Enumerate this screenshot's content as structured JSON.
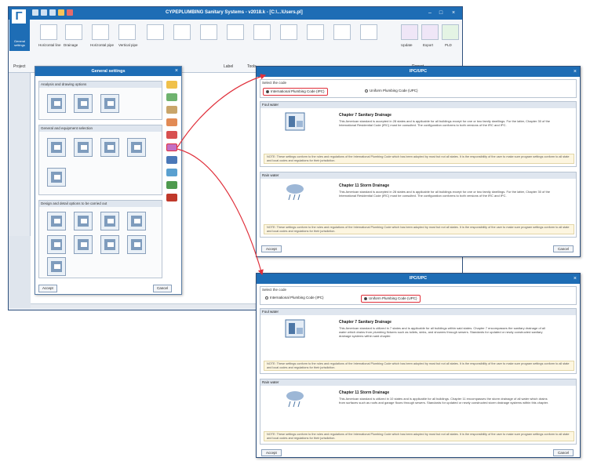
{
  "app": {
    "title": "CYPEPLUMBING Sanitary Systems - v2018.k - [C:\\...\\Users.pl]",
    "ribbon_tabs": [
      "Project",
      "Label",
      "Tools",
      "Report"
    ],
    "general_settings_label": "General settings",
    "ribbon_groups": [
      "Horizontal line",
      "Drainage",
      "Horizontal pipe",
      "Vertical pipe",
      "Update",
      "Export",
      "PLD"
    ]
  },
  "general_settings_dialog": {
    "title": "General settings",
    "sections": [
      {
        "title": "Analysis and drawing options"
      },
      {
        "title": "General and equipment selection"
      },
      {
        "title": "Design and detail options to be carried out"
      }
    ],
    "accept": "Accept",
    "cancel": "Cancel"
  },
  "ipc_dialog": {
    "title": "IPC/UPC",
    "select_label": "Select the code",
    "option_ipc": "International Plumbing Code (IPC)",
    "option_upc": "Uniform Plumbing Code (UPC)",
    "foul_label": "Foul water",
    "foul_title": "Chapter 7 Sanitary Drainage",
    "foul_body": "This American standard is accepted in 28 states and is applicable for all buildings except for one or two family dwellings. For the latter, Chapter 30 of the International Residential Code (IRC) must be consulted. The configuration conforms to both versions of the IRC and IPC.",
    "note": "NOTE: These settings conform to the rules and regulations of the International Plumbing Code which has been adopted by most but not all states. It is the responsibility of the user to make sure program settings conform to all state and local codes and regulations for their jurisdiction.",
    "rain_label": "Rain water",
    "rain_title": "Chapter 11 Storm Drainage",
    "rain_body": "This American standard is accepted in 28 states and is applicable for all buildings except for one or two family dwellings. For the latter, Chapter 30 of the International Residential Code (IRC) must be consulted. The configuration conforms to both versions of the IRC and IPC.",
    "accept": "Accept",
    "cancel": "Cancel"
  },
  "upc_dialog": {
    "title": "IPC/UPC",
    "select_label": "Select the code",
    "option_ipc": "International Plumbing Code (IPC)",
    "option_upc": "Uniform Plumbing Code (UPC)",
    "foul_label": "Foul water",
    "foul_title": "Chapter 7 Sanitary Drainage",
    "foul_body": "This American standard is utilized in 7 states and is applicable for all buildings within said states. Chapter 7 encompasses the sanitary drainage of all water which drains from plumbing fixtures such as toilets, sinks, and showers through sewers. Standards for updated or newly constructed sanitary drainage systems within said chapter.",
    "note": "NOTE: These settings conform to the rules and regulations of the International Plumbing Code which has been adopted by most but not all states. It is the responsibility of the user to make sure program settings conform to all state and local codes and regulations for their jurisdiction.",
    "rain_label": "Rain water",
    "rain_title": "Chapter 11 Storm Drainage",
    "rain_body": "This American standard is utilized in 10 states and is applicable for all buildings. Chapter 11 encompasses the storm drainage of all water which drains from surfaces such as roofs and garage floors through sewers. Standards for updated or newly constructed storm drainage systems within this chapter.",
    "accept": "Accept",
    "cancel": "Cancel"
  },
  "colors": {
    "title_blue": "#1e6db5",
    "highlight_red": "#e0303b",
    "note_bg": "#fdf6e0"
  }
}
